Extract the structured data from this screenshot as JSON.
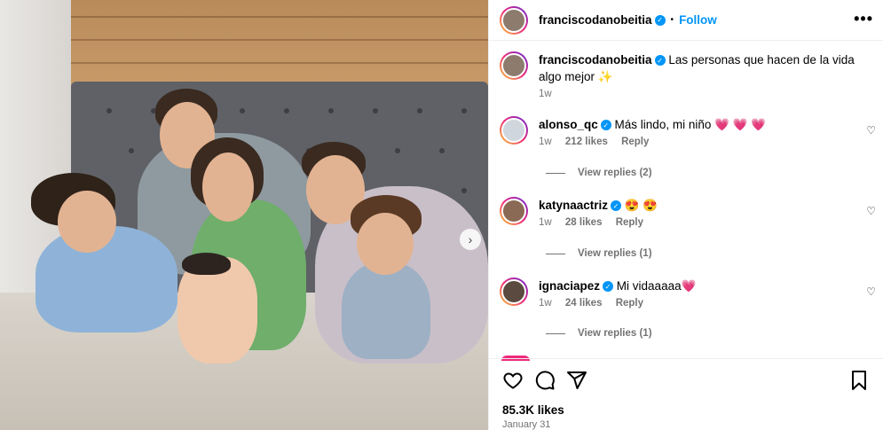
{
  "post": {
    "author": "franciscodanobeitia",
    "follow_label": "Follow",
    "more_label": "•••",
    "caption_text": "Las personas que hacen de la vida algo mejor",
    "caption_emoji": "✨",
    "caption_time": "1w",
    "likes": "85.3K likes",
    "date": "January 31",
    "next_glyph": "›"
  },
  "comments": [
    {
      "user": "alonso_qc",
      "text": "Más lindo, mi niño",
      "emoji": "💗 💗 💗",
      "time": "1w",
      "likes": "212 likes",
      "reply": "Reply",
      "view_replies": "View replies (2)"
    },
    {
      "user": "katynaactriz",
      "text": "",
      "emoji": "😍 😍",
      "time": "1w",
      "likes": "28 likes",
      "reply": "Reply",
      "view_replies": "View replies (1)"
    },
    {
      "user": "ignaciapez",
      "text": "Mi vidaaaaa",
      "emoji": "💗",
      "time": "1w",
      "likes": "24 likes",
      "reply": "Reply",
      "view_replies": "View replies (1)"
    }
  ],
  "icons": {
    "like": "heart-icon",
    "comment": "comment-icon",
    "share": "share-icon",
    "save": "bookmark-icon",
    "verified": "verified-badge-icon",
    "next": "chevron-right-icon"
  },
  "colors": {
    "accent": "#0095f6",
    "muted": "#737373",
    "emoji_pink": "#e8246b"
  }
}
